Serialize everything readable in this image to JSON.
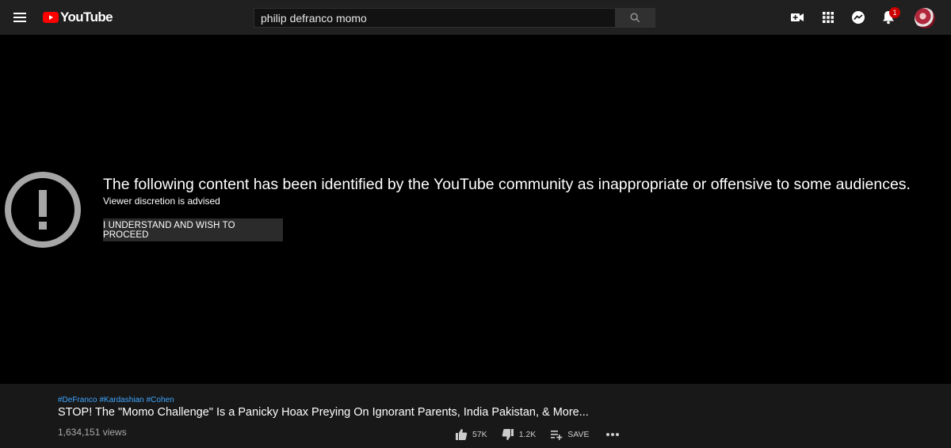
{
  "app": {
    "brand": "YouTube"
  },
  "header": {
    "search_value": "philip defranco momo",
    "notification_count": "1"
  },
  "warning": {
    "title": "The following content has been identified by the YouTube community as inappropriate or offensive to some audiences.",
    "subtitle": "Viewer discretion is advised",
    "proceed_label": "I UNDERSTAND AND WISH TO PROCEED"
  },
  "video": {
    "hashtags": [
      "#DeFranco",
      "#Kardashian",
      "#Cohen"
    ],
    "title": "STOP! The \"Momo Challenge\" Is a Panicky Hoax Preying On Ignorant Parents, India Pakistan, & More...",
    "views": "1,634,151 views",
    "likes": "57K",
    "dislikes": "1.2K",
    "save_label": "SAVE"
  },
  "icons": {
    "menu": "hamburger-menu-icon",
    "search": "search-icon",
    "create": "video-camera-plus-icon",
    "apps": "grid-apps-icon",
    "messages": "messages-icon",
    "notifications": "bell-icon",
    "warning": "exclamation-circle-icon",
    "like": "thumbs-up-icon",
    "dislike": "thumbs-down-icon",
    "save": "playlist-add-icon",
    "more": "more-horizontal-icon"
  },
  "colors": {
    "brand_red": "#ff0000",
    "link_blue": "#3ea6ff",
    "badge_red": "#cc0000",
    "topbar_bg": "#202020",
    "info_bg": "#181818"
  }
}
